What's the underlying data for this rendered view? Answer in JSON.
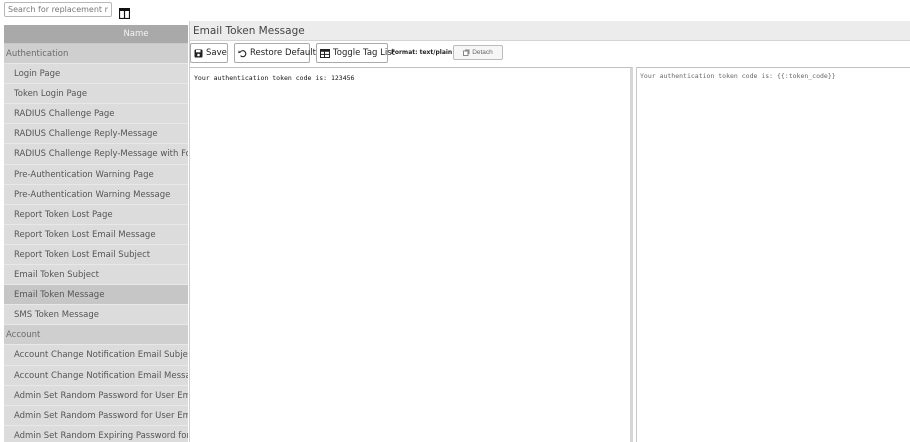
{
  "search": {
    "placeholder": "Search for replacement messag"
  },
  "list": {
    "column_header": "Name",
    "rows": [
      {
        "type": "group",
        "label": "Authentication"
      },
      {
        "type": "item",
        "label": "Login Page"
      },
      {
        "type": "item",
        "label": "Token Login Page"
      },
      {
        "type": "item",
        "label": "RADIUS Challenge Page"
      },
      {
        "type": "item",
        "label": "RADIUS Challenge Reply-Message"
      },
      {
        "type": "item",
        "label": "RADIUS Challenge Reply-Message with FortiTok"
      },
      {
        "type": "item",
        "label": "Pre-Authentication Warning Page"
      },
      {
        "type": "item",
        "label": "Pre-Authentication Warning Message"
      },
      {
        "type": "item",
        "label": "Report Token Lost Page"
      },
      {
        "type": "item",
        "label": "Report Token Lost Email Message"
      },
      {
        "type": "item",
        "label": "Report Token Lost Email Subject"
      },
      {
        "type": "item",
        "label": "Email Token Subject"
      },
      {
        "type": "item",
        "label": "Email Token Message",
        "selected": true
      },
      {
        "type": "item",
        "label": "SMS Token Message"
      },
      {
        "type": "group",
        "label": "Account"
      },
      {
        "type": "item",
        "label": "Account Change Notification Email Subject"
      },
      {
        "type": "item",
        "label": "Account Change Notification Email Message"
      },
      {
        "type": "item",
        "label": "Admin Set Random Password for User Email Sub"
      },
      {
        "type": "item",
        "label": "Admin Set Random Password for User Email Me"
      },
      {
        "type": "item",
        "label": "Admin Set Random Expiring Password for User"
      }
    ]
  },
  "editor": {
    "title": "Email Token Message",
    "toolbar": {
      "save_label": "Save",
      "restore_label": "Restore Default",
      "toggle_label": "Toggle Tag List",
      "format_label": "Format: text/plain",
      "detach_label": "Detach"
    },
    "preview_text": "Your authentication token code is: 123456",
    "source_text": "Your authentication token code is: {{:token_code}}"
  }
}
